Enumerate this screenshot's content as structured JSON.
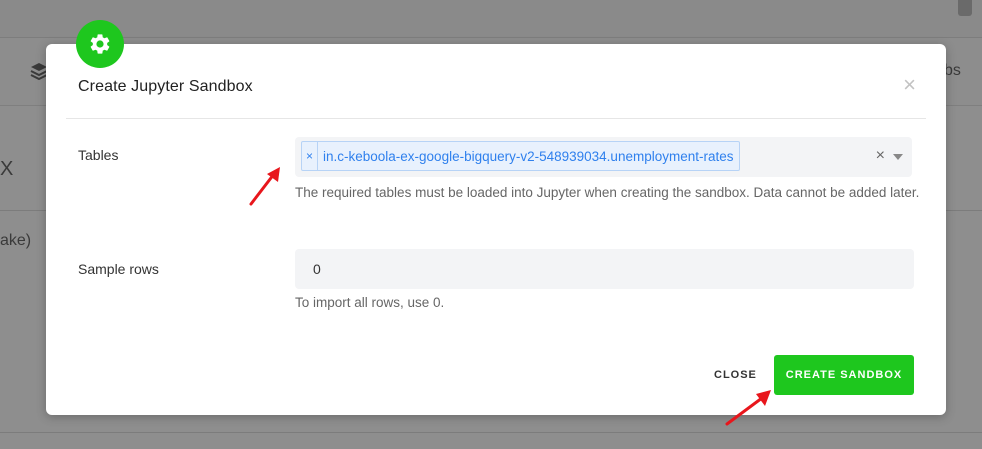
{
  "background": {
    "side_text_1": "X",
    "side_text_2": "ake)",
    "side_text_3": "bs"
  },
  "modal": {
    "title": "Create Jupyter Sandbox",
    "close_glyph": "×",
    "icon": "gear-icon",
    "accent_color": "#1ec71e"
  },
  "tables": {
    "label": "Tables",
    "selected": [
      {
        "remove": "×",
        "label": "in.c-keboola-ex-google-bigquery-v2-548939034.unemployment-rates"
      }
    ],
    "clear_glyph": "×",
    "help": "The required tables must be loaded into Jupyter when creating the sandbox. Data cannot be added later."
  },
  "sample_rows": {
    "label": "Sample rows",
    "value": "0",
    "help": "To import all rows, use 0."
  },
  "footer": {
    "close_label": "CLOSE",
    "create_label": "CREATE SANDBOX"
  }
}
